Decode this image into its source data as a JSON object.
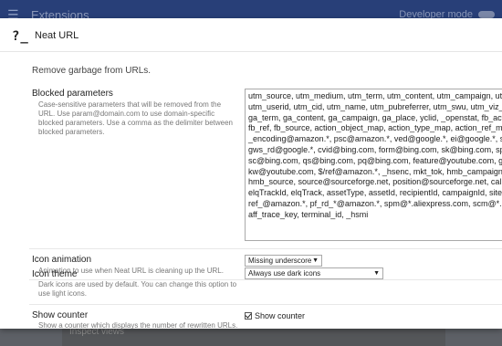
{
  "background": {
    "title": "Extensions",
    "developer_mode_label": "Developer mode",
    "footer_text": "Inspect views"
  },
  "dialog": {
    "icon_glyph": "?_",
    "title": "Neat URL",
    "description": "Remove garbage from URLs.",
    "blocked": {
      "label": "Blocked parameters",
      "help": "Case-sensitive parameters that will be removed from the URL. Use param@domain.com to use domain-specific blocked parameters. Use a comma as the delimiter between blocked parameters.",
      "value": "utm_source, utm_medium, utm_term, utm_content, utm_campaign, utm_reader,\nutm_userid, utm_cid, utm_name, utm_pubreferrer, utm_swu, utm_viz_id,\nga_term, ga_content, ga_campaign, ga_place, yclid, _openstat, fb_action_ids,\nfb_ref, fb_source, action_object_map, action_type_map, action_ref_map,\n_encoding@amazon.*, psc@amazon.*, ved@google.*, ei@google.*, sei@google.*,\ngws_rd@google.*, cvid@bing.com, form@bing.com, sk@bing.com, sp@bing.com,\nsc@bing.com, qs@bing.com, pq@bing.com, feature@youtube.com, gclid,\nkw@youtube.com, $/ref@amazon.*, _hsenc, mkt_tok, hmb_campaign, hmb_medium,\nhmb_source, source@sourceforge.net, position@sourceforge.net, callback@bilibili.com,\nelqTrackId, elqTrack, assetType, assetId, recipientId, campaignId, siteId,\nref_@amazon.*, pf_rd_*@amazon.*, spm@*.aliexpress.com, scm@*.aliexpress.com,\naff_trace_key, terminal_id, _hsmi"
    },
    "icon_animation": {
      "label": "Icon animation",
      "help": "Animation to use when Neat URL is cleaning up the URL.",
      "selected": "Missing underscore"
    },
    "icon_theme": {
      "label": "Icon theme",
      "help": "Dark icons are used by default. You can change this option to use light icons.",
      "selected": "Always use dark icons"
    },
    "show_counter": {
      "label": "Show counter",
      "help": "Show a counter which displays the number of rewritten URLs.",
      "checkbox_label": "Show counter",
      "checked": true
    }
  }
}
